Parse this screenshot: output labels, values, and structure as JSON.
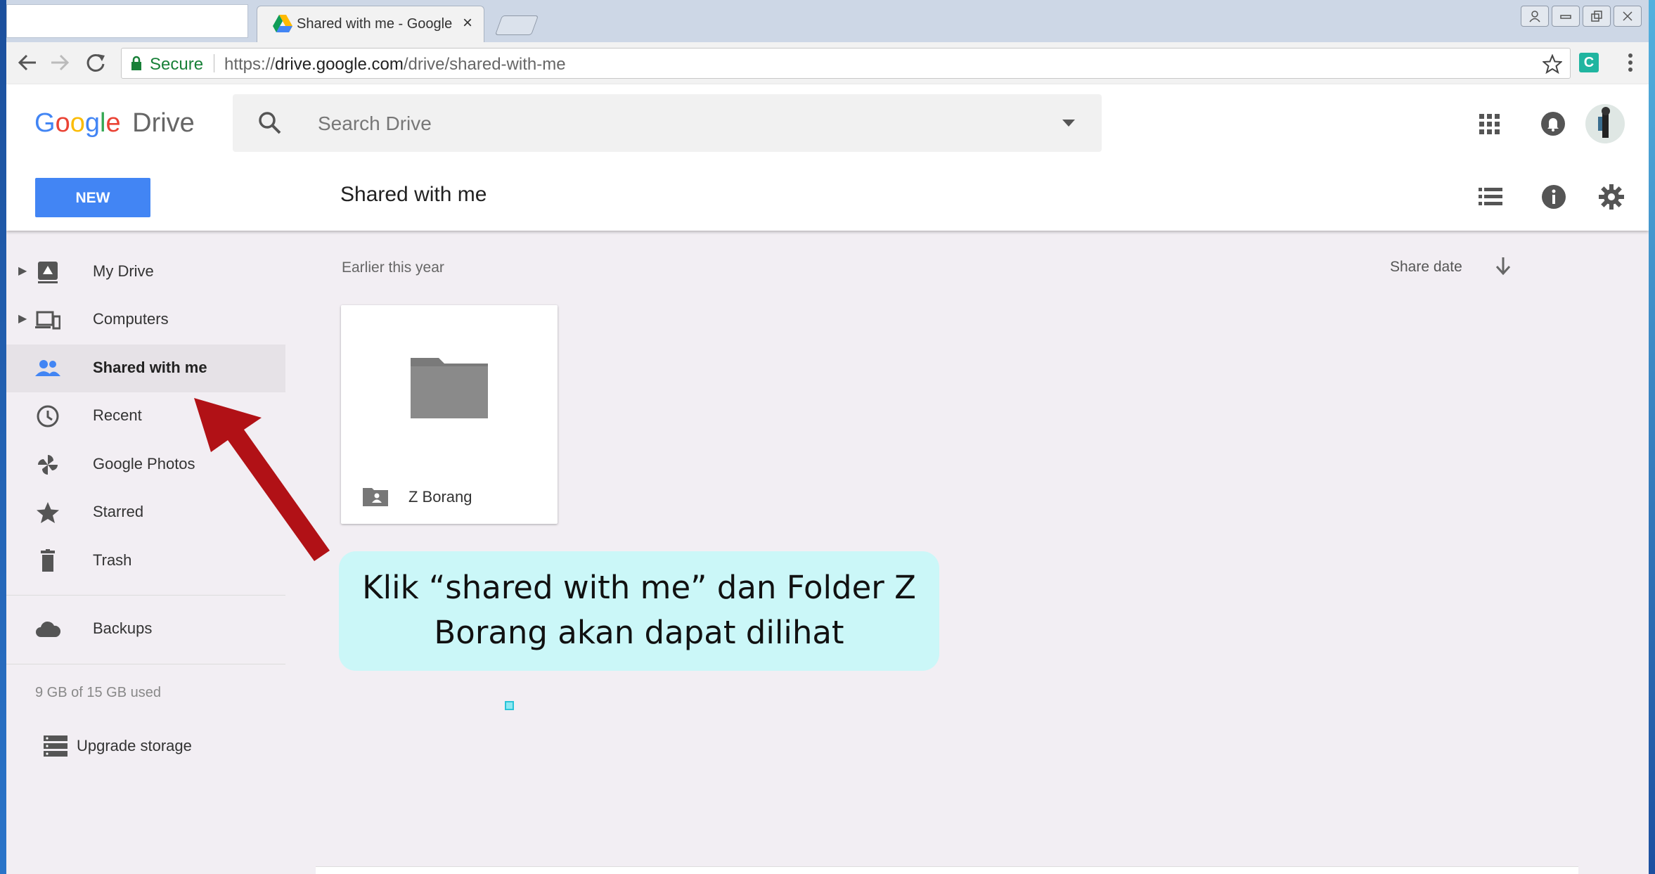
{
  "browser": {
    "tab_title": "Shared with me - Google",
    "tab_close": "×",
    "secure_label": "Secure",
    "url_scheme": "https://",
    "url_host": "drive.google.com",
    "url_path": "/drive/shared-with-me",
    "extension_label": "C"
  },
  "header": {
    "logo_g1": "G",
    "logo_o1": "o",
    "logo_o2": "o",
    "logo_g2": "g",
    "logo_l": "l",
    "logo_e": "e",
    "logo_product": "Drive",
    "search_placeholder": "Search Drive",
    "new_button": "NEW",
    "page_title": "Shared with me"
  },
  "sidebar": {
    "items": [
      {
        "label": "My Drive",
        "icon": "my-drive-icon",
        "expandable": true
      },
      {
        "label": "Computers",
        "icon": "computers-icon",
        "expandable": true
      },
      {
        "label": "Shared with me",
        "icon": "people-icon",
        "active": true
      },
      {
        "label": "Recent",
        "icon": "clock-icon"
      },
      {
        "label": "Google Photos",
        "icon": "pinwheel-icon"
      },
      {
        "label": "Starred",
        "icon": "star-icon"
      },
      {
        "label": "Trash",
        "icon": "trash-icon"
      },
      {
        "label": "Backups",
        "icon": "cloud-icon"
      }
    ],
    "storage_text": "9 GB of 15 GB used",
    "upgrade_label": "Upgrade storage"
  },
  "main": {
    "section_label": "Earlier this year",
    "sort_label": "Share date",
    "folders": [
      {
        "name": "Z Borang"
      }
    ]
  },
  "annotation": {
    "line1": "Klik “shared with me” dan Folder  Z",
    "line2": "Borang akan dapat dilihat",
    "arrow_color": "#b11116"
  },
  "colors": {
    "primary": "#4285f4",
    "callout_bg": "#cbf7f8"
  }
}
